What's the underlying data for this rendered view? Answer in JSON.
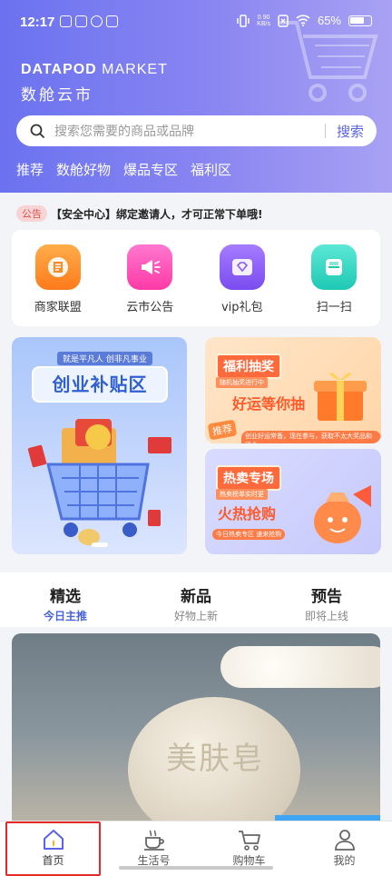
{
  "status_bar": {
    "time": "12:17",
    "net_speed_top": "0.90",
    "net_speed_unit": "KB/s",
    "battery": "65%"
  },
  "brand": {
    "name_bold": "DATAPOD",
    "name_light": " MARKET",
    "name_cn": "数舱云市"
  },
  "search": {
    "placeholder": "搜索您需要的商品或品牌",
    "button": "搜索"
  },
  "categories": [
    "推荐",
    "数舱好物",
    "爆品专区",
    "福利区"
  ],
  "notice": {
    "tag": "公告",
    "text": "【安全中心】绑定邀请人，才可正常下单哦!"
  },
  "quick_actions": [
    {
      "label": "商家联盟",
      "color": "#ff8a2a"
    },
    {
      "label": "云市公告",
      "color": "#ff4fb8"
    },
    {
      "label": "vip礼包",
      "color": "#8a5cf5"
    },
    {
      "label": "扫一扫",
      "color": "#2ad3c0"
    }
  ],
  "banners": {
    "main": {
      "subtitle": "就是平凡人 创非凡事业",
      "title": "创业补贴区"
    },
    "lottery": {
      "title": "福利抽奖",
      "subtitle": "随机抽奖进行中",
      "slogan": "好运等你抽",
      "footer": "创业好运常备，现在参与，获取不太大奖品和现金",
      "corner": "推荐"
    },
    "hot": {
      "title": "热卖专场",
      "subtitle": "热卖榜单实时更",
      "slogan": "火热抢购",
      "footer": "今日热卖专区 速来抢购"
    }
  },
  "tabs": [
    {
      "title": "精选",
      "subtitle": "今日主推",
      "active": true
    },
    {
      "title": "新品",
      "subtitle": "好物上新",
      "active": false
    },
    {
      "title": "预告",
      "subtitle": "即将上线",
      "active": false
    }
  ],
  "product": {
    "soap_text": "美肤皂"
  },
  "bottom_nav": [
    {
      "label": "首页",
      "icon": "home-icon"
    },
    {
      "label": "生活号",
      "icon": "coffee-cup-icon"
    },
    {
      "label": "购物车",
      "icon": "cart-icon"
    },
    {
      "label": "我的",
      "icon": "user-icon"
    }
  ],
  "colors": {
    "accent": "#5b63e6",
    "hero_start": "#6b72ef",
    "hero_end": "#a9a2f3",
    "active_tab": "#4a63d8",
    "highlight": "#e52a2a"
  }
}
